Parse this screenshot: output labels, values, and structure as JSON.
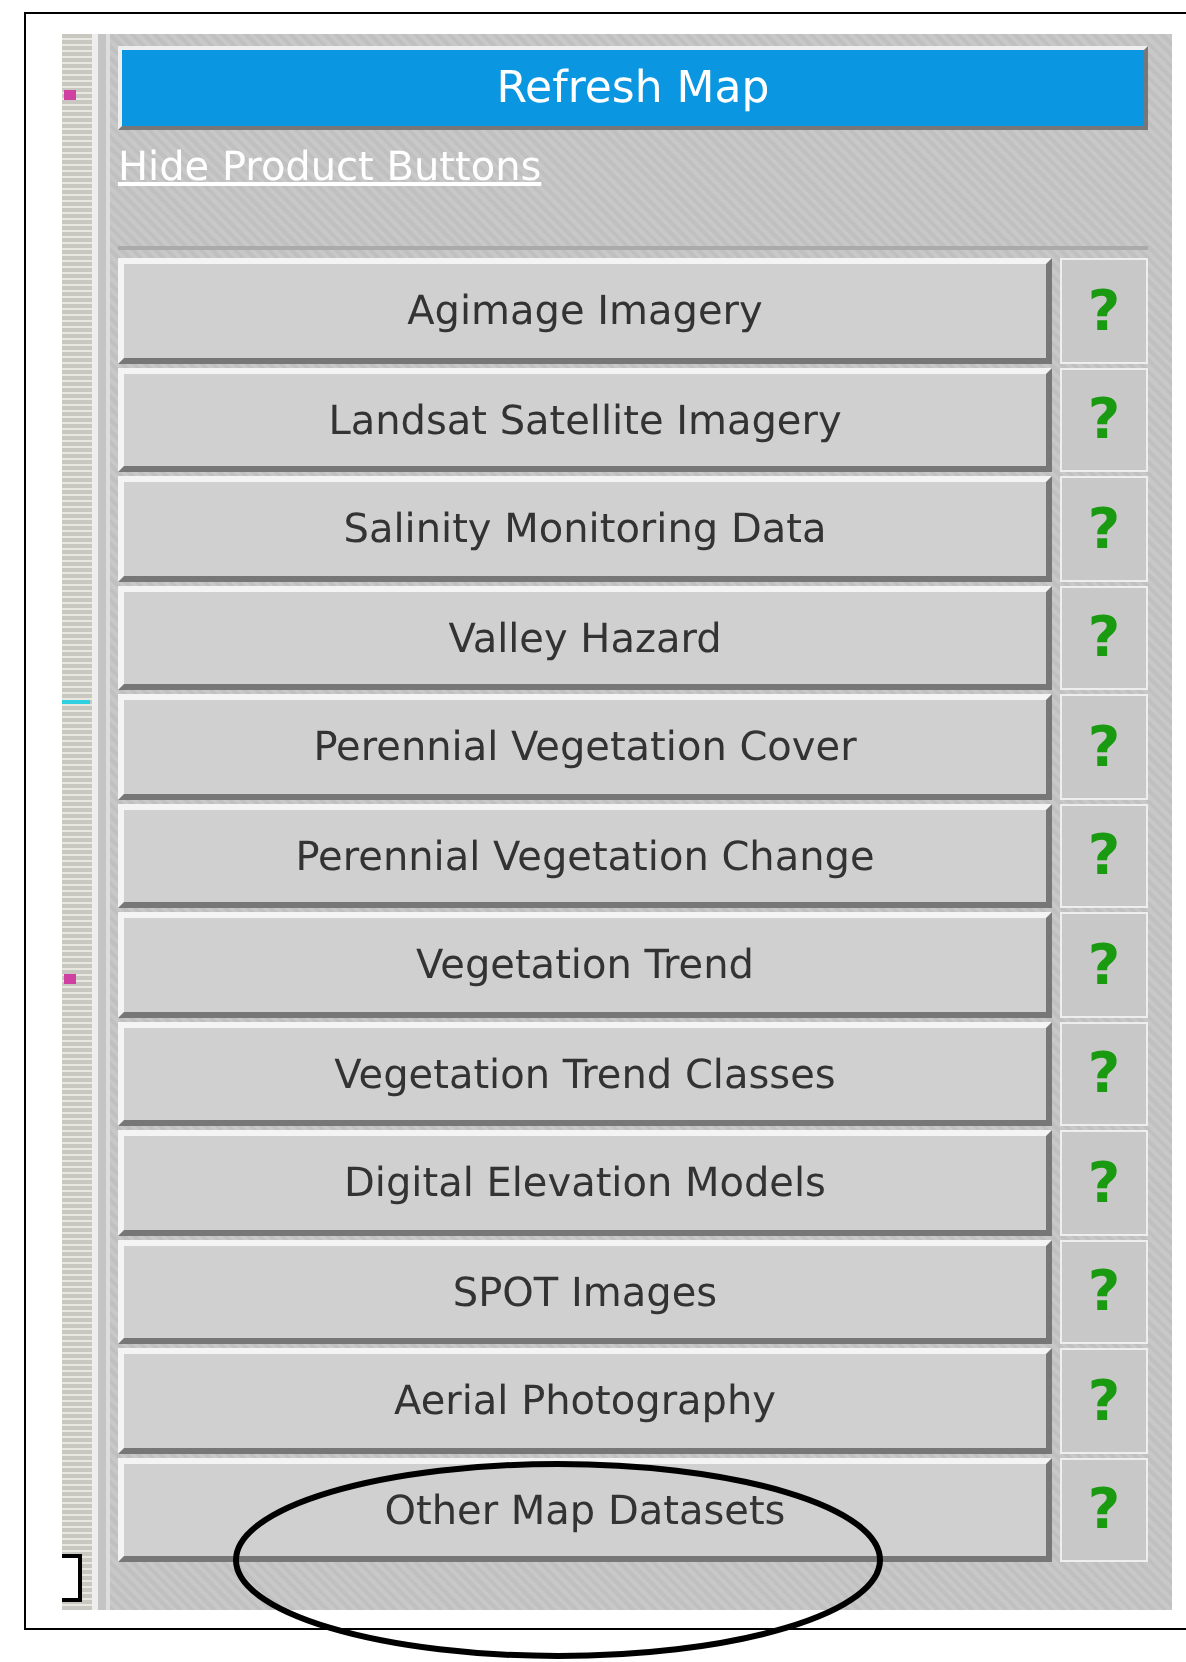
{
  "refresh_button": "Refresh Map",
  "hide_link": "Hide Product Buttons",
  "products": [
    {
      "label": "Agimage Imagery",
      "help": "?"
    },
    {
      "label": "Landsat Satellite Imagery",
      "help": "?"
    },
    {
      "label": "Salinity Monitoring Data",
      "help": "?"
    },
    {
      "label": "Valley Hazard",
      "help": "?"
    },
    {
      "label": "Perennial Vegetation Cover",
      "help": "?"
    },
    {
      "label": "Perennial Vegetation Change",
      "help": "?"
    },
    {
      "label": "Vegetation Trend",
      "help": "?"
    },
    {
      "label": "Vegetation Trend Classes",
      "help": "?"
    },
    {
      "label": "Digital Elevation Models",
      "help": "?"
    },
    {
      "label": "SPOT Images",
      "help": "?"
    },
    {
      "label": "Aerial Photography",
      "help": "?"
    },
    {
      "label": "Other Map Datasets",
      "help": "?"
    }
  ]
}
